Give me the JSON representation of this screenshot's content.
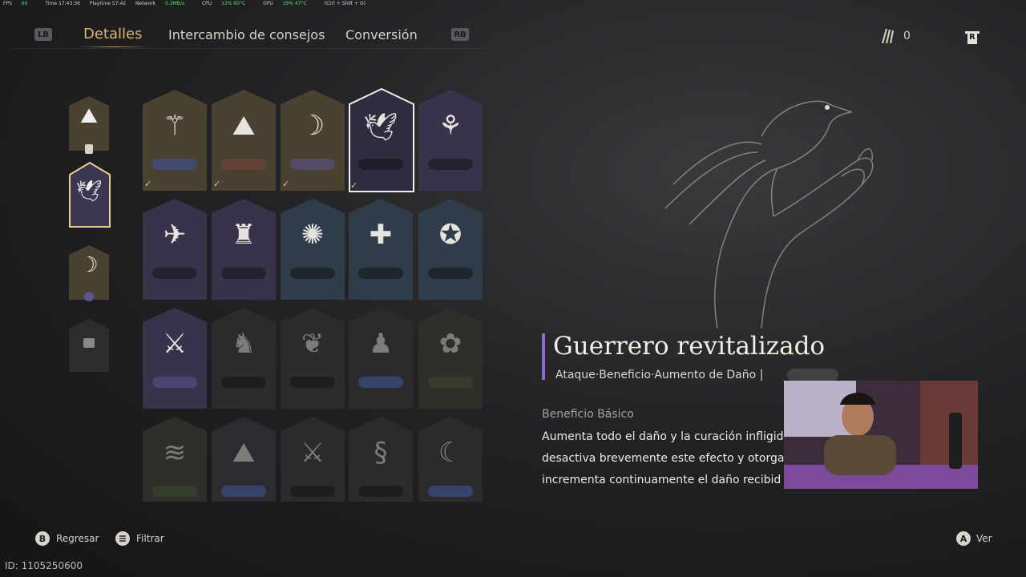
{
  "perf": {
    "fps_label": "FPS",
    "fps": "60",
    "time": "Time 17:43:36",
    "playtime": "Playtime 57:42",
    "network_label": "Network",
    "network": "0.3MB/s",
    "cpu_label": "CPU",
    "cpu": "13% 60°C",
    "gpu_label": "GPU",
    "gpu": "39% 47°C",
    "hint": "(Ctrl + Shift + O)"
  },
  "header": {
    "lb": "LB",
    "rb": "RB",
    "tabs": [
      {
        "label": "Detalles",
        "active": true
      },
      {
        "label": "Intercambio de consejos",
        "active": false
      },
      {
        "label": "Conversión",
        "active": false
      }
    ],
    "currency_count": "0",
    "r_button": "R"
  },
  "detail": {
    "title": "Guerrero revitalizado",
    "tags": "Ataque·Beneficio·Aumento de Daño  |",
    "section_label": "Beneficio Básico",
    "description_lines": [
      "Aumenta todo el daño y la curación infligid",
      "desactiva brevemente este efecto y otorga",
      "incrementa continuamente el daño recibid"
    ]
  },
  "footer": {
    "back_button": "B",
    "back_label": "Regresar",
    "filter_label": "Filtrar",
    "view_button": "A",
    "view_label": "Ver",
    "id_text": "ID: 1105250600"
  },
  "colors": {
    "accent_gold": "#c9a45c",
    "accent_purple": "#8b6cc9",
    "card_gold": "#4a4230",
    "card_purple": "#3a3550",
    "card_blue": "#30404e",
    "card_dark": "#2b2b2d"
  },
  "icons": {
    "side": [
      "mountains-icon",
      "bird-on-hand-icon",
      "spirit-mask-icon",
      "locked-slot-icon"
    ],
    "grid_row1": [
      "staff-icon",
      "mountains-icon",
      "spirit-mask-icon",
      "bird-on-hand-icon",
      "sprout-icon"
    ],
    "grid_row2": [
      "swallows-icon",
      "warrior-statue-icon",
      "spinning-figure-icon",
      "cross-blade-icon",
      "strongman-icon"
    ],
    "grid_row3": [
      "swordsman-icon",
      "horse-locked-icon",
      "beast-locked-icon",
      "figure-locked-icon",
      "flower-locked-icon"
    ],
    "grid_row4": [
      "wave-locked-icon",
      "mountain-locked-icon",
      "blade-locked-icon",
      "dragon-locked-icon",
      "scythe-locked-icon"
    ]
  }
}
